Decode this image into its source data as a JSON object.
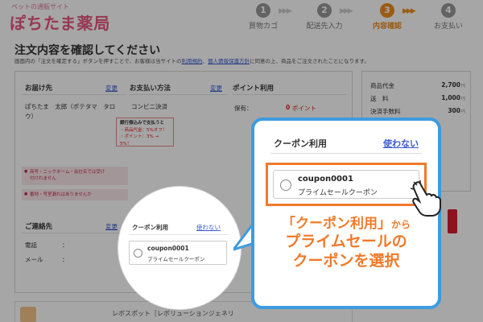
{
  "header": {
    "logo_sub": "ペットの通販サイト",
    "logo_main": "ぽちたま薬局",
    "steps": [
      {
        "num": "1",
        "label": "買物カゴ",
        "active": false
      },
      {
        "num": "2",
        "label": "配送先入力",
        "active": false
      },
      {
        "num": "3",
        "label": "内容確認",
        "active": true
      },
      {
        "num": "4",
        "label": "お支払い",
        "active": false
      }
    ]
  },
  "page": {
    "title": "注文内容を確認してください",
    "note_pre": "画面内の「注文を確定する」ボタンを押すことで、お客様は当サイトの",
    "note_link1": "利用規約",
    "note_mid": "、",
    "note_link2": "個人情報保護方針",
    "note_post": "に同意の上、商品をご注文されたことになります。"
  },
  "shipping": {
    "heading": "お届け先",
    "change": "変更",
    "name_line1": "ぽちたま　太郎（ポテタマ　タロ",
    "name_line2": "ウ）",
    "warn1_line1": "商号・ニックネーム・会社名では受け",
    "warn1_line2": "付けれません",
    "warn2": "番地・号室漏れはありませんか"
  },
  "payment": {
    "heading": "お支払い方法",
    "change": "変更",
    "method": "コンビニ決済",
    "promo_line1": "銀行振込みで支払うと",
    "promo_line2": "・商品代金：5%オフ！",
    "promo_line3": "・ポイント：3% → 5%！"
  },
  "points": {
    "heading": "ポイント利用",
    "held_label": "保有：",
    "held_value": "0",
    "held_unit": "ポイント"
  },
  "contact": {
    "heading": "ご連絡先",
    "change": "変更",
    "phone_label": "電話",
    "email_label": "メール"
  },
  "summary": {
    "rows": [
      {
        "label": "商品代金",
        "value": "2,700",
        "unit": "円"
      },
      {
        "label": "送　料",
        "value": "1,000",
        "unit": "円"
      },
      {
        "label": "決済手数料",
        "value": "300",
        "unit": "円"
      }
    ]
  },
  "coupon_small": {
    "heading": "クーポン利用",
    "link": "使わない",
    "code": "coupon0001",
    "name": "プライムセールクーポン"
  },
  "coupon_zoom": {
    "heading": "クーポン利用",
    "link": "使わない",
    "code": "coupon0001",
    "name": "プライムセールクーポン"
  },
  "caption": {
    "line1_main": "「クーポン利用」",
    "line1_small": "から",
    "line2": "プライムセールの",
    "line3": "クーポンを選択"
  },
  "bottom": {
    "text": "レボスポット［レボリューションジェネリ"
  },
  "colors": {
    "brand_pink": "#e8557f",
    "step_active": "#f08c1e",
    "callout_blue": "#3d9be0",
    "highlight_orange": "#f07a2a",
    "link_blue": "#3a5bd0"
  }
}
